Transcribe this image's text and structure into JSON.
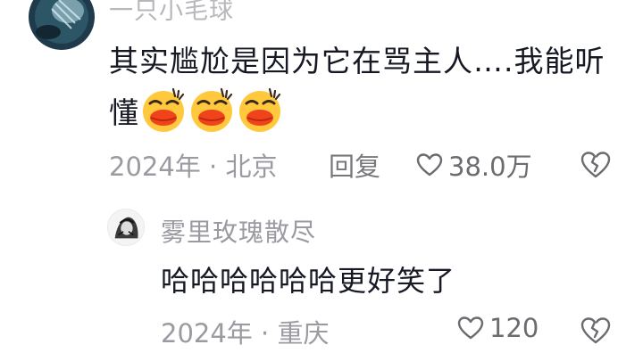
{
  "comment": {
    "username": "一只小毛球",
    "text": "其实尴尬是因为它在骂主人….我能听懂",
    "emoji_count": 3,
    "emoji_icon": "kissing-face-emoji",
    "meta": "2024年 · 北京",
    "reply_label": "回复",
    "likes": "38.0万"
  },
  "reply": {
    "username": "雾里玫瑰散尽",
    "text": "哈哈哈哈哈哈更好笑了",
    "meta": "2024年 · 重庆",
    "likes": "120"
  },
  "icons": {
    "like": "heart-outline-icon",
    "dislike": "broken-heart-icon"
  },
  "colors": {
    "text_primary": "#161823",
    "text_secondary": "#9a9aa0",
    "background": "#ffffff"
  }
}
